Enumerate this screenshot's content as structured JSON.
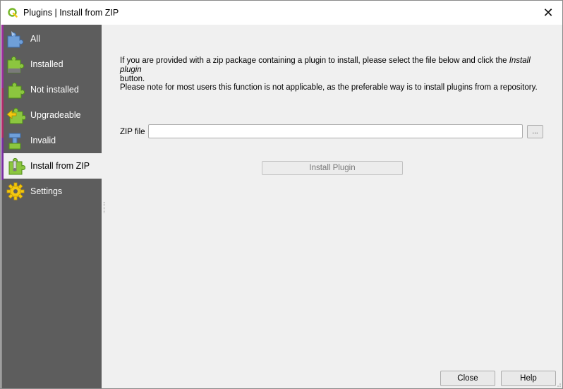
{
  "window": {
    "title": "Plugins | Install from ZIP",
    "close_glyph": "✕"
  },
  "sidebar": {
    "items": [
      {
        "label": "All",
        "icon": "puzzle-all-icon"
      },
      {
        "label": "Installed",
        "icon": "puzzle-installed-icon"
      },
      {
        "label": "Not installed",
        "icon": "puzzle-not-installed-icon"
      },
      {
        "label": "Upgradeable",
        "icon": "puzzle-upgradeable-icon"
      },
      {
        "label": "Invalid",
        "icon": "puzzle-invalid-icon"
      },
      {
        "label": "Install from ZIP",
        "icon": "puzzle-zip-icon",
        "selected": true
      },
      {
        "label": "Settings",
        "icon": "gear-settings-icon"
      }
    ]
  },
  "main": {
    "intro_before": "If you are provided with a zip package containing a plugin to install, please select the file below and click the ",
    "intro_italic": "Install plugin",
    "intro_after": " button.",
    "note": "Please note for most users this function is not applicable, as the preferable way is to install plugins from a repository.",
    "zip_label": "ZIP file",
    "zip_value": "",
    "browse_label": "...",
    "install_label": "Install Plugin"
  },
  "footer": {
    "close_label": "Close",
    "help_label": "Help"
  },
  "colors": {
    "sidebar_bg": "#5d5d5d",
    "window_bg": "#f0f0f0",
    "qgis_green": "#77b82a"
  }
}
